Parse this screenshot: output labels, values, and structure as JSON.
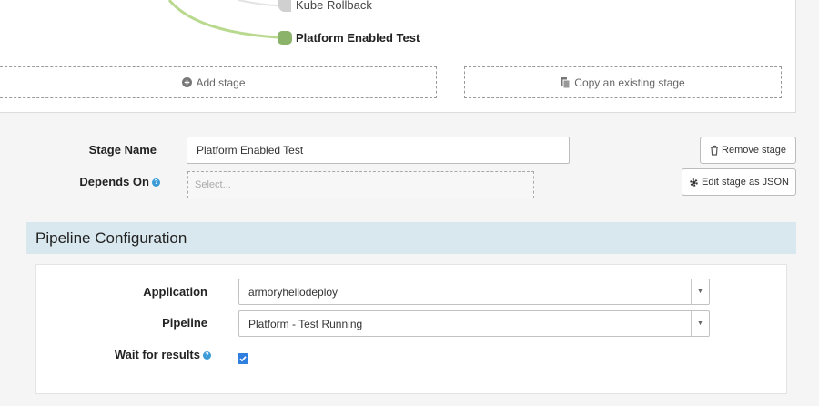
{
  "graph": {
    "nodes": [
      {
        "label": "Kube Rollback",
        "state": "inactive"
      },
      {
        "label": "Platform Enabled Test",
        "state": "selected"
      }
    ],
    "add_stage_label": "Add stage",
    "copy_stage_label": "Copy an existing stage"
  },
  "stage": {
    "name_label": "Stage Name",
    "name_value": "Platform Enabled Test",
    "depends_label": "Depends On",
    "depends_placeholder": "Select...",
    "remove_label": "Remove stage",
    "edit_json_label": "Edit stage as JSON"
  },
  "pipeline_config": {
    "title": "Pipeline Configuration",
    "application_label": "Application",
    "application_value": "armoryhellodeploy",
    "pipeline_label": "Pipeline",
    "pipeline_value": "Platform - Test Running",
    "wait_label": "Wait for results",
    "wait_checked": true
  },
  "colors": {
    "edge_green": "#b9d98f",
    "node_active": "#8bb36a",
    "node_inactive": "#d0d0d0",
    "section_header_bg": "#d9e8ee",
    "checkbox_blue": "#2f7fe0",
    "help_blue": "#3b9bd6"
  }
}
